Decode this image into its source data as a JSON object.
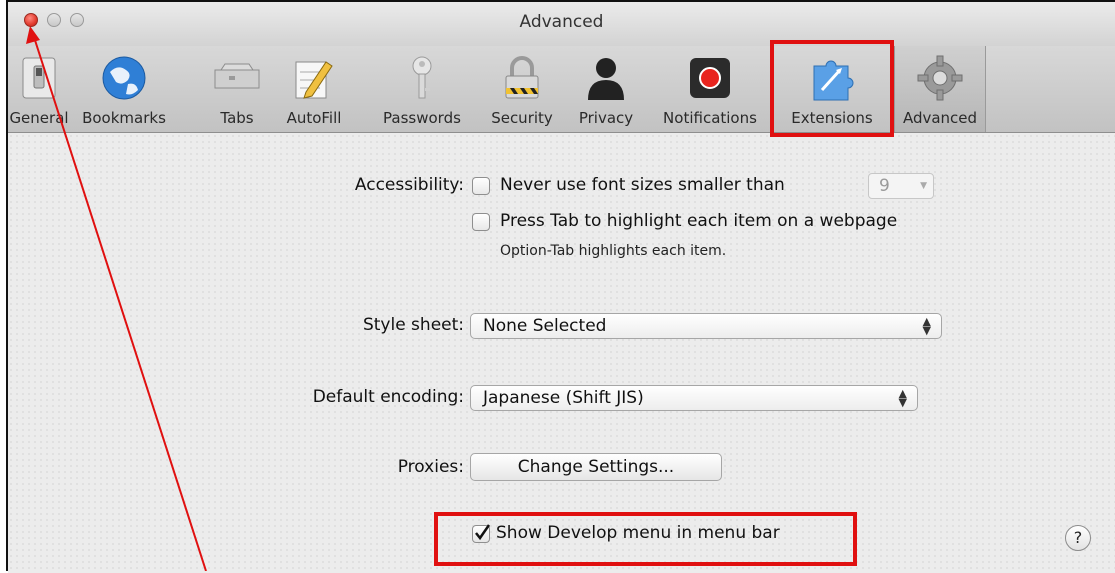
{
  "window": {
    "title": "Advanced"
  },
  "toolbar": {
    "items": [
      {
        "label": "General",
        "icon": "general-switch-icon"
      },
      {
        "label": "Bookmarks",
        "icon": "globe-icon"
      },
      {
        "label": "Tabs",
        "icon": "tabs-icon"
      },
      {
        "label": "AutoFill",
        "icon": "autofill-pencil-icon"
      },
      {
        "label": "Passwords",
        "icon": "key-icon"
      },
      {
        "label": "Security",
        "icon": "padlock-icon"
      },
      {
        "label": "Privacy",
        "icon": "person-silhouette-icon"
      },
      {
        "label": "Notifications",
        "icon": "notification-record-icon"
      },
      {
        "label": "Extensions",
        "icon": "puzzle-icon"
      },
      {
        "label": "Advanced",
        "icon": "gear-icon"
      }
    ],
    "selected": "Advanced"
  },
  "accessibility": {
    "label": "Accessibility:",
    "min_font_label": "Never use font sizes smaller than",
    "min_font_value": "9",
    "min_font_checked": false,
    "tab_highlight_label": "Press Tab to highlight each item on a webpage",
    "tab_highlight_checked": false,
    "tab_hint": "Option-Tab highlights each item."
  },
  "stylesheet": {
    "label": "Style sheet:",
    "value": "None Selected"
  },
  "encoding": {
    "label": "Default encoding:",
    "value": "Japanese (Shift JIS)"
  },
  "proxies": {
    "label": "Proxies:",
    "button": "Change Settings..."
  },
  "develop": {
    "label": "Show Develop menu in menu bar",
    "checked": true
  },
  "help": {
    "label": "?"
  },
  "annotation_color": "#e01010"
}
